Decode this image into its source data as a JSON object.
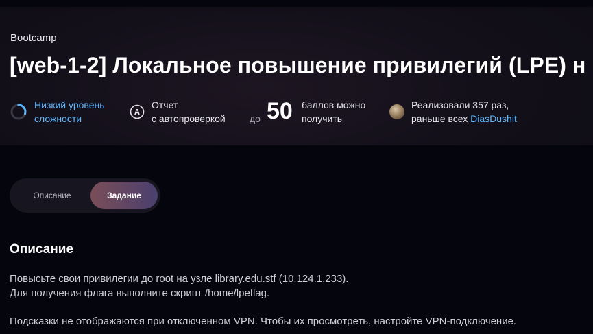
{
  "header": {
    "breadcrumb": "Bootcamp",
    "title": "[web-1-2] Локальное повышение привилегий (LPE) н"
  },
  "stats": {
    "difficulty": {
      "icon": "difficulty-ring-icon",
      "line1": "Низкий уровень",
      "line2": "сложности",
      "color": "#5bb8ff"
    },
    "report": {
      "icon": "auto-check-icon",
      "line1": "Отчет",
      "line2": "с автопроверкой"
    },
    "points": {
      "prefix": "до",
      "value": "50",
      "line1": "баллов можно",
      "line2": "получить"
    },
    "solved": {
      "line1": "Реализовали 357 раз,",
      "line2_prefix": "раньше всех",
      "first_user": "DiasDushit"
    }
  },
  "tabs": [
    {
      "label": "Описание",
      "active": false
    },
    {
      "label": "Задание",
      "active": true
    }
  ],
  "content": {
    "section_title": "Описание",
    "paragraph1_line1": "Повысьте свои привилегии до root на узле library.edu.stf (10.124.1.233).",
    "paragraph1_line2": "Для получения флага выполните скрипт /home/lpeflag.",
    "paragraph2": "Подсказки не отображаются при отключенном VPN. Чтобы их просмотреть, настройте VPN-подключение."
  },
  "colors": {
    "accent": "#5bb8ff",
    "background": "#05050d",
    "hero": "#120f19"
  }
}
